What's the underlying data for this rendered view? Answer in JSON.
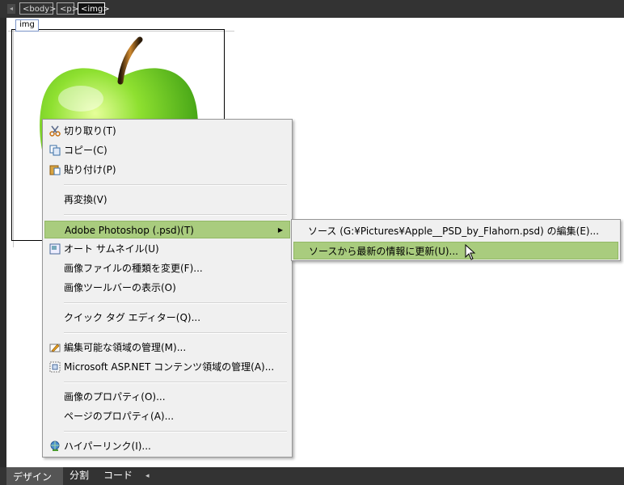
{
  "tagbar": {
    "scroll_left_glyph": "◂",
    "tags": [
      "<body>",
      "<p>",
      "<img>"
    ]
  },
  "surface": {
    "selection_label": "img"
  },
  "context_menu": {
    "items": [
      {
        "label": "切り取り(T)",
        "icon": "scissors-icon"
      },
      {
        "label": "コピー(C)",
        "icon": "copy-icon"
      },
      {
        "label": "貼り付け(P)",
        "icon": "paste-icon"
      },
      {
        "label": "再変換(V)"
      },
      {
        "label": "Adobe Photoshop (.psd)(T)",
        "submenu_arrow": "▶"
      },
      {
        "label": "オート サムネイル(U)",
        "icon": "thumbnail-icon"
      },
      {
        "label": "画像ファイルの種類を変更(F)..."
      },
      {
        "label": "画像ツールバーの表示(O)"
      },
      {
        "label": "クイック タグ エディター(Q)..."
      },
      {
        "label": "編集可能な領域の管理(M)...",
        "icon": "editable-region-icon"
      },
      {
        "label": "Microsoft ASP.NET コンテンツ領域の管理(A)...",
        "icon": "aspnet-region-icon"
      },
      {
        "label": "画像のプロパティ(O)..."
      },
      {
        "label": "ページのプロパティ(A)..."
      },
      {
        "label": "ハイパーリンク(I)...",
        "icon": "hyperlink-icon"
      }
    ]
  },
  "submenu": {
    "items": [
      {
        "label": "ソース (G:¥Pictures¥Apple__PSD_by_Flahorn.psd) の編集(E)..."
      },
      {
        "label": "ソースから最新の情報に更新(U)..."
      }
    ]
  },
  "viewbar": {
    "tabs": [
      "デザイン",
      "分割",
      "コード"
    ],
    "scroll_glyph": "◂"
  },
  "colors": {
    "highlight": "#a9cc7e",
    "chrome": "#333333"
  }
}
